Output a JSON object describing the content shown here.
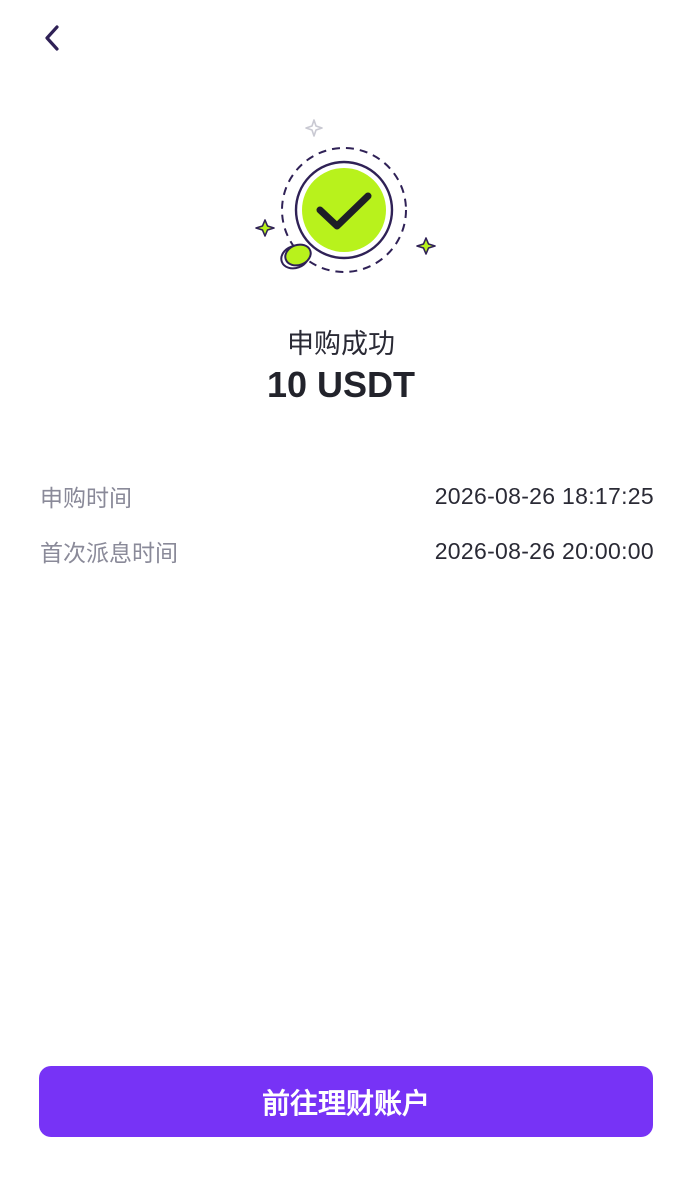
{
  "header": {
    "back_icon": "chevron-left-icon"
  },
  "result": {
    "icon": "success-check-icon",
    "title": "申购成功",
    "amount": "10 USDT"
  },
  "details": [
    {
      "label": "申购时间",
      "value": "2026-08-26 18:17:25"
    },
    {
      "label": "首次派息时间",
      "value": "2026-08-26 20:00:00"
    }
  ],
  "action": {
    "button_label": "前往理财账户"
  },
  "colors": {
    "accent": "#7733f6",
    "success_fill": "#b8f21c",
    "icon_outline": "#2f2156"
  }
}
